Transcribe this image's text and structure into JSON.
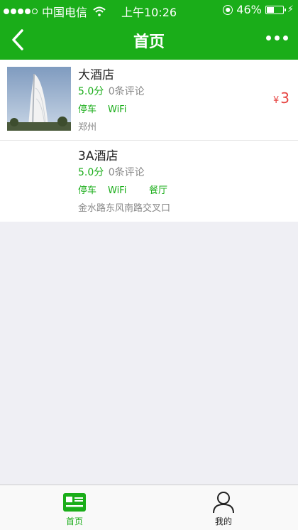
{
  "status_bar": {
    "carrier": "中国电信",
    "time": "上午10:26",
    "battery": "46%",
    "battery_level": 0.46
  },
  "nav": {
    "title": "首页"
  },
  "hotels": [
    {
      "name": "大酒店",
      "score": "5.0分",
      "reviews": "0条评论",
      "tags": [
        "停车",
        "WiFi"
      ],
      "address": "郑州",
      "price_symbol": "¥",
      "price": "3"
    },
    {
      "name": "3A酒店",
      "score": "5.0分",
      "reviews": "0条评论",
      "tags": [
        "停车",
        "WiFi",
        "餐厅"
      ],
      "address": "金水路东风南路交叉口"
    }
  ],
  "tabs": [
    {
      "label": "首页",
      "icon": "home-card-icon",
      "active": true
    },
    {
      "label": "我的",
      "icon": "user-icon",
      "active": false
    }
  ],
  "colors": {
    "brand": "#1aad19",
    "price": "#e64340"
  }
}
